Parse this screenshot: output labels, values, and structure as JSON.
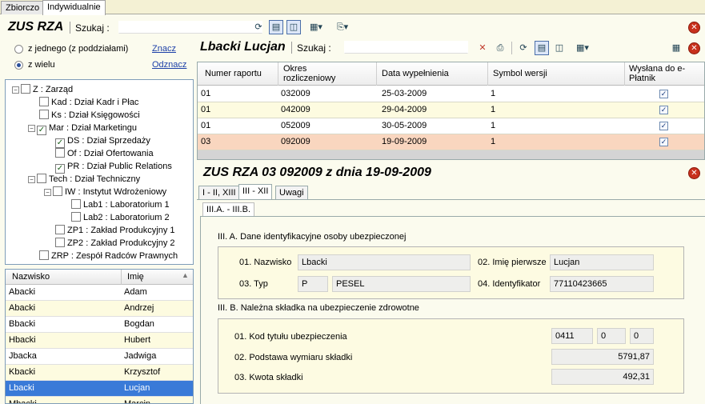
{
  "top_tabs": [
    "Zbiorczo",
    "Indywidualnie"
  ],
  "main": {
    "title": "ZUS RZA",
    "search_label": "Szukaj :"
  },
  "left": {
    "radio_one": "z jednego (z poddziałami)",
    "radio_many": "z wielu",
    "link_mark": "Znacz",
    "link_unmark": "Odznacz",
    "tree": [
      {
        "label": "Z : Zarząd",
        "checked": false
      },
      {
        "label": "Kad : Dział Kadr i Płac",
        "checked": false
      },
      {
        "label": "Ks : Dział Księgowości",
        "checked": false
      },
      {
        "label": "Mar : Dział Marketingu",
        "checked": true
      },
      {
        "label": "DS : Dział Sprzedaży",
        "checked": true
      },
      {
        "label": "Of : Dział Ofertowania",
        "checked": false
      },
      {
        "label": "PR : Dział Public Relations",
        "checked": true
      },
      {
        "label": "Tech : Dział Techniczny",
        "checked": false
      },
      {
        "label": "IW : Instytut Wdrożeniowy",
        "checked": false
      },
      {
        "label": "Lab1 : Laboratorium 1",
        "checked": false
      },
      {
        "label": "Lab2 : Laboratorium 2",
        "checked": false
      },
      {
        "label": "ZP1 : Zakład Produkcyjny 1",
        "checked": false
      },
      {
        "label": "ZP2 : Zakład Produkcyjny 2",
        "checked": false
      },
      {
        "label": "ZRP : Zespół Radców Prawnych",
        "checked": false
      }
    ],
    "list_headers": [
      "Nazwisko",
      "Imię"
    ],
    "list": [
      [
        "Abacki",
        "Adam"
      ],
      [
        "Abacki",
        "Andrzej"
      ],
      [
        "Bbacki",
        "Bogdan"
      ],
      [
        "Hbacki",
        "Hubert"
      ],
      [
        "Jbacka",
        "Jadwiga"
      ],
      [
        "Kbacki",
        "Krzysztof"
      ],
      [
        "Lbacki",
        "Lucjan"
      ],
      [
        "Mbacki",
        "Marcin"
      ]
    ],
    "selected_row": 6
  },
  "person": {
    "name": "Lbacki Lucjan",
    "search_label": "Szukaj :"
  },
  "grid": {
    "headers": [
      "Numer raportu",
      "Okres rozliczeniowy",
      "Data wypełnienia",
      "Symbol wersji",
      "Wysłana do e-Płatnik"
    ],
    "rows": [
      [
        "01",
        "032009",
        "25-03-2009",
        "1",
        "✓"
      ],
      [
        "01",
        "042009",
        "29-04-2009",
        "1",
        "✓"
      ],
      [
        "01",
        "052009",
        "30-05-2009",
        "1",
        "✓"
      ],
      [
        "03",
        "092009",
        "19-09-2009",
        "1",
        "✓"
      ]
    ],
    "selected_row": 3
  },
  "detail": {
    "title": "ZUS RZA 03 092009 z dnia 19-09-2009",
    "tabs": [
      "I - II, XIII",
      "III - XII",
      "Uwagi"
    ],
    "subtab": "III.A. - III.B.",
    "section_a": "III. A. Dane identyfikacyjne osoby ubezpieczonej",
    "section_b": "III. B. Należna składka na ubezpieczenie zdrowotne",
    "fields": {
      "nazwisko_label": "01. Nazwisko",
      "nazwisko": "Lbacki",
      "imie_label": "02. Imię pierwsze",
      "imie": "Lucjan",
      "typ_label": "03. Typ",
      "typ": "P",
      "typ_name": "PESEL",
      "id_label": "04. Identyfikator",
      "id": "77110423665",
      "kod_label": "01. Kod tytułu ubezpieczenia",
      "kod1": "0411",
      "kod2": "0",
      "kod3": "0",
      "podstawa_label": "02. Podstawa wymiaru składki",
      "podstawa": "5791,87",
      "kwota_label": "03. Kwota składki",
      "kwota": "492,31"
    }
  }
}
